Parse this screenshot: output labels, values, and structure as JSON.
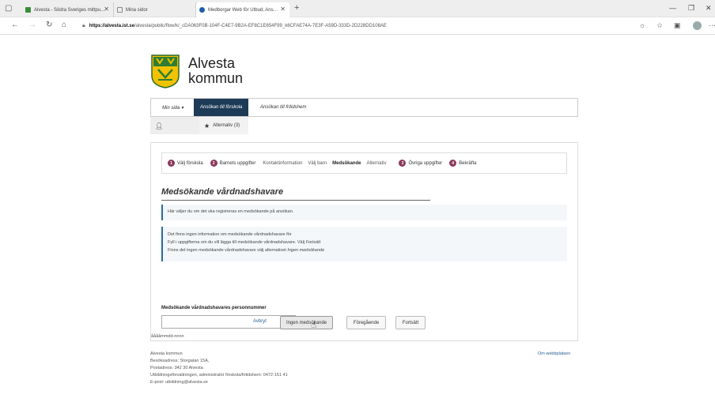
{
  "browser": {
    "tabs": [
      {
        "label": "Alvesta - Södra Sveriges mitt​pu…",
        "color": "#3a8d3a"
      },
      {
        "label": "Mina sidor",
        "color": "#888888"
      },
      {
        "label": "Medborgar Web för Utbud, Ans…",
        "color": "#1d5fa8"
      }
    ],
    "url_host": "https://alvesta.ist.se",
    "url_path": "/alvesta/public/flow/k/_cDA063F0B-104F-C4E7-9B2A-EF8C1E654F99_k6CFAE74A-7E3F-A59D-333D-2D228DD108AE"
  },
  "site": {
    "logo_line1": "Alvesta",
    "logo_line2": "kommun",
    "brand_color": "#1d3a57"
  },
  "nav": {
    "items": [
      "Min sida ▾",
      "Ansökan till förskola",
      "Ansökan till fritidshem"
    ],
    "sub_user": "",
    "sub_alternatives": "Alternativ (3)"
  },
  "steps": [
    {
      "num": "1",
      "label": "Välj förskola",
      "badge": true
    },
    {
      "num": "2",
      "label": "Barnets uppgifter",
      "badge": true
    },
    {
      "num": "",
      "label": "Kontaktinformation",
      "badge": false
    },
    {
      "num": "",
      "label": "Välj barn",
      "badge": false
    },
    {
      "num": "",
      "label": "Medsökande",
      "badge": false,
      "bold": true
    },
    {
      "num": "",
      "label": "Alternativ",
      "badge": false
    },
    {
      "num": "3",
      "label": "Övriga uppgifter",
      "badge": true
    },
    {
      "num": "4",
      "label": "Bekräfta",
      "badge": true
    }
  ],
  "form": {
    "heading": "Medsökande vårdnadshavare",
    "info1": "Här väljer du om det ska registreras en medsökande på ansökan.",
    "info2_line1": "Det finns ingen information om medsökande vårdnadshavare för",
    "info2_line2_a": "Fyll i uppgifterna om du vill lägga till medsökande vårdnadshavare. Välj ",
    "info2_line2_b": "Fortsätt",
    "info2_line3_a": "Finns det ingen medsökande vårdnadshavare välj alternativet ",
    "info2_line3_b": "Ingen medsökande",
    "field_label": "Medsökande vårdnadshavares personnummer",
    "field_value": "",
    "field_hint": "ååååmmdd-nnnn",
    "cancel": "Avbryt",
    "no_applicant": "Ingen medsökande",
    "previous": "Föregående",
    "next": "Fortsätt"
  },
  "footer": {
    "line1": "Alvesta kommun",
    "line2": "Besöksadress: Storgatan 15A,",
    "line3": "Postadress: 342 30 Alvesta",
    "line4": "Utbildningsförvaltningen, administratör förskola/fritidshem: 0472-151 41",
    "line5": "E-post: utbildning@alvesta.se",
    "link": "Om webbplatsen"
  }
}
